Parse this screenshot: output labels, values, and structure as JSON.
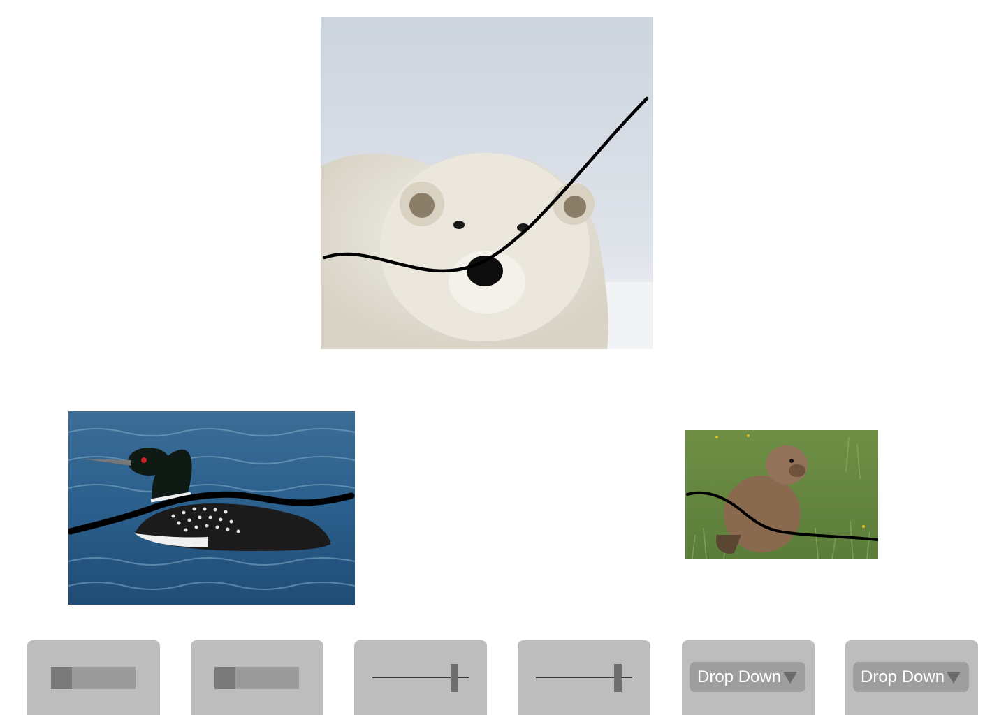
{
  "images": {
    "polar_bear": {
      "subject": "polar bear"
    },
    "loon": {
      "subject": "common loon swimming"
    },
    "beaver": {
      "subject": "beaver on grass"
    }
  },
  "controls": {
    "progress_bars": [
      {
        "value": 0.25
      },
      {
        "value": 0.25
      }
    ],
    "sliders": [
      {
        "value": 0.85
      },
      {
        "value": 0.85
      }
    ],
    "dropdowns": [
      {
        "label": "Drop Down"
      },
      {
        "label": "Drop Down"
      }
    ]
  },
  "icons": {
    "dropdown_caret": "triangle-down-icon"
  },
  "colors": {
    "panel": "#bdbdbd",
    "control_gray": "#9e9e9e",
    "indicator_gray": "#6e6e6e",
    "annotation_stroke": "#000000"
  }
}
